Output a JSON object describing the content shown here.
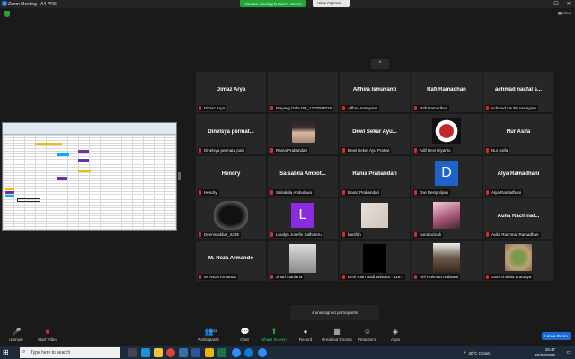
{
  "window": {
    "title": "Zoom Meeting - A4-VRIII",
    "minimize": "—",
    "maximize": "☐",
    "close": "✕"
  },
  "banner": {
    "viewing": "You are viewing lessons' screen",
    "view_options": "View Options ⌄"
  },
  "top_right": {
    "view_label": "▦ View"
  },
  "tiles": [
    {
      "big": "Dimaz Arya",
      "label": "Dimaz Arya",
      "photo": ""
    },
    {
      "big": "",
      "label": "Mayang Dafa DR_1202003018",
      "photo": ""
    },
    {
      "big": "Alfhira Ismayanti",
      "label": "Alfhira Ismayanti",
      "photo": ""
    },
    {
      "big": "Rafi Ramadhan",
      "label": "Rafi Ramadhan",
      "photo": ""
    },
    {
      "big": "achmad naufal s...",
      "label": "achmad naufal saslagian",
      "photo": ""
    },
    {
      "big": "Dinelsya permat...",
      "label": "Dinelsya permata putri",
      "photo": ""
    },
    {
      "big": "",
      "label": "Rania Prabandari",
      "photo": "girl"
    },
    {
      "big": "Dewi Sekar Ayu...",
      "label": "Dewi Sekar Ayu Pratiwi",
      "photo": ""
    },
    {
      "big": "",
      "label": "Adif Devi Riyanto",
      "photo": "logo"
    },
    {
      "big": "Nur Asifa",
      "label": "Nur Asifa",
      "photo": ""
    },
    {
      "big": "Hendry",
      "label": "Hendry",
      "photo": ""
    },
    {
      "big": "Salsabila Ambot...",
      "label": "Salsabila Amboluwo",
      "photo": ""
    },
    {
      "big": "Rania Prabandari",
      "label": "Rania Prabandari",
      "photo": ""
    },
    {
      "big": "",
      "label": "Dwi Restybilyan",
      "photo": "letter-d"
    },
    {
      "big": "Alya Ramadhani",
      "label": "Alya Ramadhani",
      "photo": ""
    },
    {
      "big": "",
      "label": "Dennis akbar_5335",
      "photo": "mask"
    },
    {
      "big": "",
      "label": "Loudya Josefin Salhuteru",
      "photo": "letter-l"
    },
    {
      "big": "",
      "label": "hanifah",
      "photo": "paper"
    },
    {
      "big": "",
      "label": "nurul azizah",
      "photo": "pink"
    },
    {
      "big": "Aulia Rachmat...",
      "label": "Aulia Rachmat Ramadhan",
      "photo": ""
    },
    {
      "big": "M. Reza Armando",
      "label": "M. Reza Armando",
      "photo": ""
    },
    {
      "big": "",
      "label": "Jihad maulana",
      "photo": "person"
    },
    {
      "big": "",
      "label": "Ermi Rian Budi Wibowo - 119...",
      "photo": "black"
    },
    {
      "big": "",
      "label": "Arif Rahman Rabbani",
      "photo": "statue"
    },
    {
      "big": "",
      "label": "zana chobita aratuuya",
      "photo": "cactus"
    }
  ],
  "photo_letters": {
    "d": "D",
    "l": "L"
  },
  "unassigned": "4 unassigned participants",
  "toolbar": {
    "unmute": "Unmute",
    "start_video": "Start Video",
    "participants": "Participants",
    "participants_count": "33",
    "chat": "Chat",
    "share_screen": "Share Screen",
    "record": "Record",
    "breakout": "Breakout Rooms",
    "reactions": "Reactions",
    "apps": "Apps",
    "leave": "Leave Room"
  },
  "taskbar": {
    "search_placeholder": "Type here to search",
    "weather": "30°C  Cerah",
    "time": "18:47",
    "date": "29/03/2022"
  },
  "colors": {
    "accent": "#23a638",
    "leave": "#1f68d8",
    "mic_muted": "#e02828"
  }
}
